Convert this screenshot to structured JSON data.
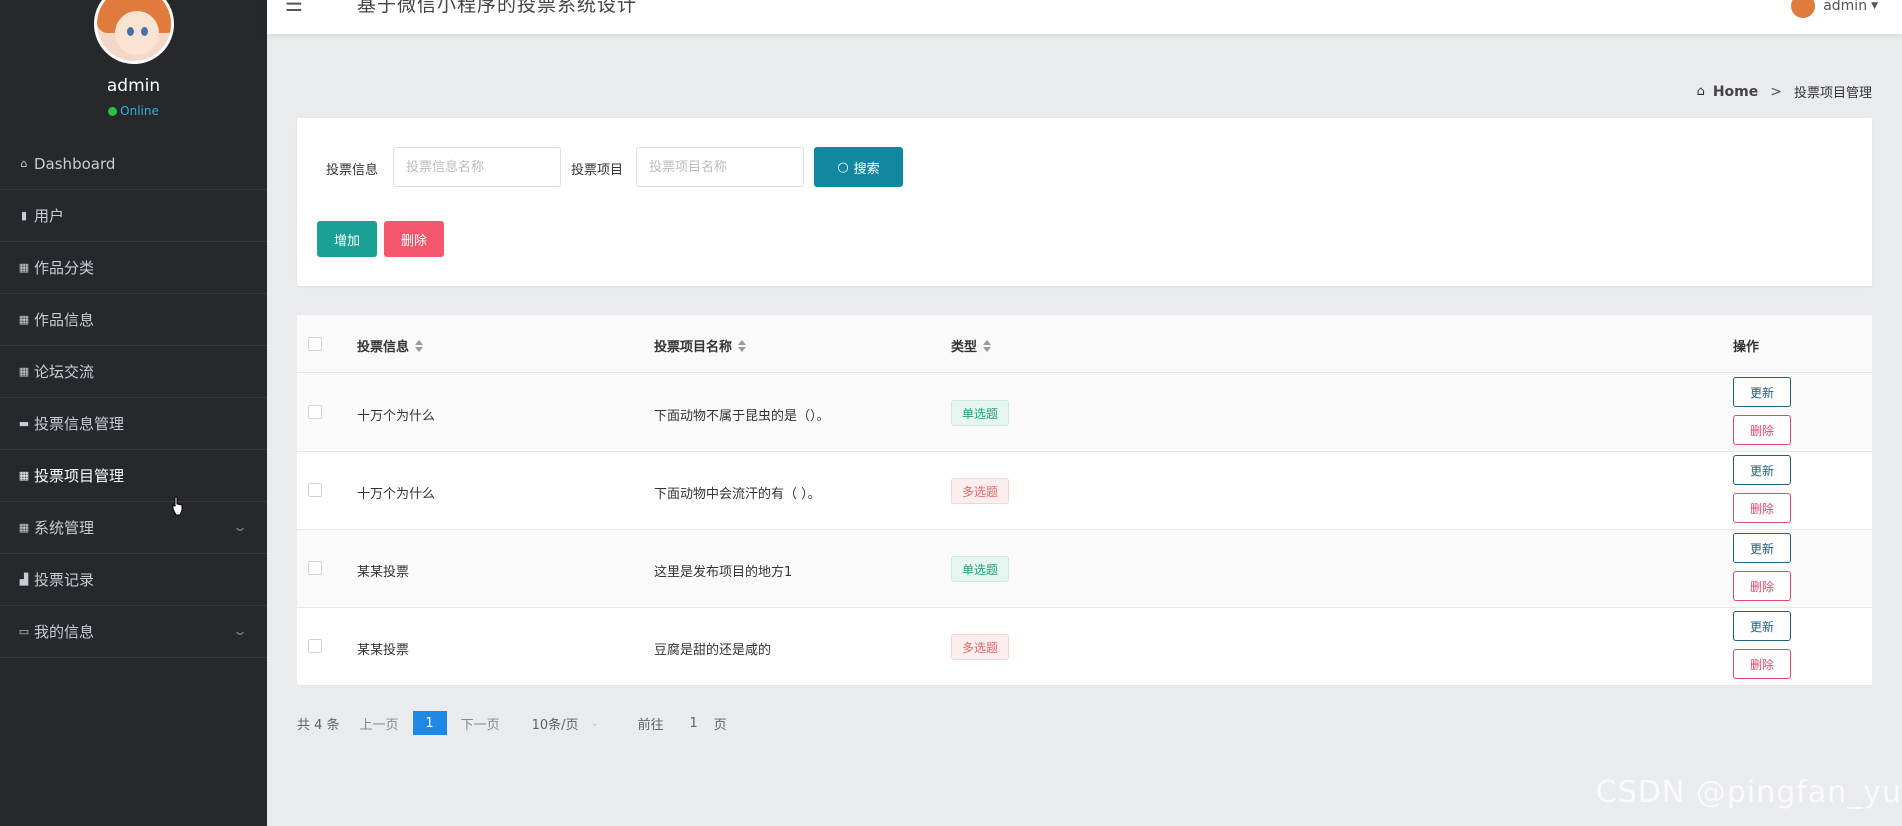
{
  "sidebar": {
    "username": "admin",
    "status": "Online",
    "items": [
      {
        "label": "Dashboard",
        "icon": "home-icon"
      },
      {
        "label": "用户",
        "icon": "user-icon"
      },
      {
        "label": "作品分类",
        "icon": "grid-icon"
      },
      {
        "label": "作品信息",
        "icon": "grid-icon"
      },
      {
        "label": "论坛交流",
        "icon": "grid-icon"
      },
      {
        "label": "投票信息管理",
        "icon": "ticket-icon"
      },
      {
        "label": "投票项目管理",
        "icon": "grid-icon"
      },
      {
        "label": "系统管理",
        "icon": "grid-icon"
      },
      {
        "label": "投票记录",
        "icon": "bar-chart-icon"
      },
      {
        "label": "我的信息",
        "icon": "card-icon"
      }
    ]
  },
  "topbar": {
    "title": "基于微信小程序的投票系统设计",
    "user": "admin"
  },
  "breadcrumb": {
    "home": "Home",
    "separator": ">",
    "current": "投票项目管理"
  },
  "search": {
    "label1": "投票信息",
    "placeholder1": "投票信息名称",
    "label2": "投票项目",
    "placeholder2": "投票项目名称",
    "search_button": "搜索",
    "add_button": "增加",
    "delete_button": "删除"
  },
  "table": {
    "headers": [
      "投票信息",
      "投票项目名称",
      "类型",
      "操作"
    ],
    "rows": [
      {
        "info": "十万个为什么",
        "item": "下面动物不属于昆虫的是（）。",
        "type": "单选题"
      },
      {
        "info": "十万个为什么",
        "item": "下面动物中会流汗的有（ ）。",
        "type": "多选题"
      },
      {
        "info": "某某投票",
        "item": "这里是发布项目的地方1",
        "type": "单选题"
      },
      {
        "info": "某某投票",
        "item": "豆腐是甜的还是咸的",
        "type": "多选题"
      }
    ],
    "update_label": "更新",
    "delete_label": "删除"
  },
  "pagination": {
    "total": "共 4 条",
    "prev": "上一页",
    "page": "1",
    "next": "下一页",
    "page_size": "10条/页",
    "goto": "前往",
    "goto_value": "1",
    "page_unit": "页"
  },
  "watermark": "CSDN @pingfan_yu",
  "colors": {
    "sidebar_bg": "#26292c",
    "search_button": "#1287a0",
    "add_button": "#1aa094",
    "delete_button": "#f4566e",
    "page_active": "#1e88e5"
  }
}
